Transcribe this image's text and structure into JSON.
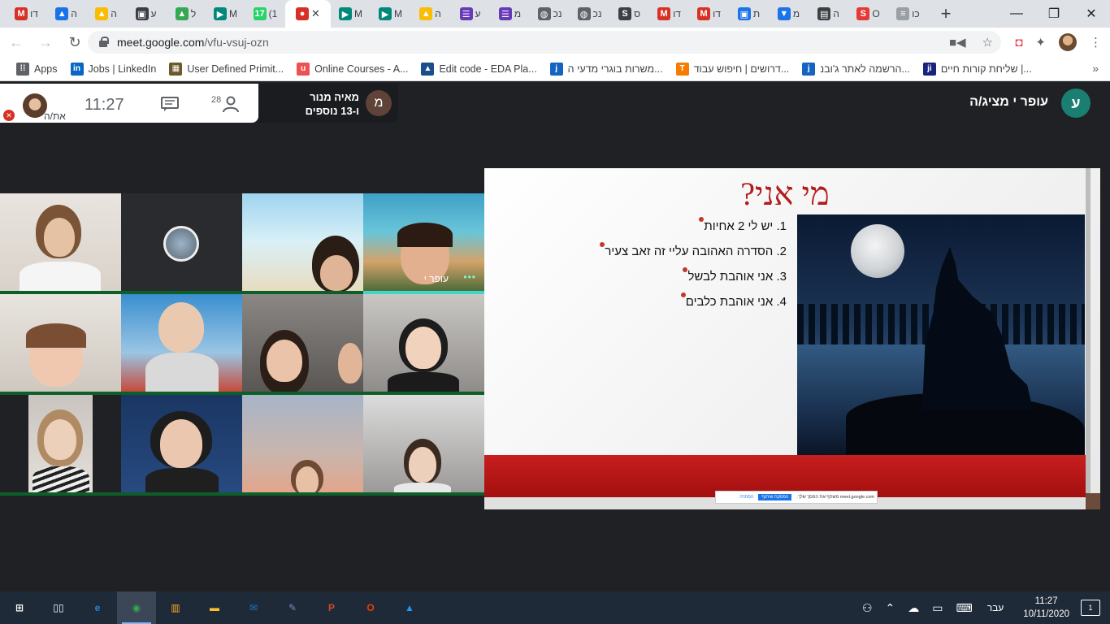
{
  "browser": {
    "tabs": [
      {
        "icon": "gmail-icon",
        "label": "דו",
        "color": "#d93025",
        "glyph": "M"
      },
      {
        "icon": "drive-icon",
        "label": "ה",
        "color": "#1a73e8",
        "glyph": "▲"
      },
      {
        "icon": "drive-icon",
        "label": "ה",
        "color": "#fbbc04",
        "glyph": "▲"
      },
      {
        "icon": "contacts-icon",
        "label": "ע",
        "color": "#3c4043",
        "glyph": "▣"
      },
      {
        "icon": "drive-icon",
        "label": "ל",
        "color": "#34a853",
        "glyph": "▲"
      },
      {
        "icon": "meet-icon",
        "label": "M",
        "color": "#00897b",
        "glyph": "▶"
      },
      {
        "icon": "whatsapp-icon",
        "label": "(1",
        "color": "#25d366",
        "glyph": "17"
      },
      {
        "icon": "record-icon",
        "label": "",
        "color": "#d93025",
        "glyph": "●",
        "active": true
      },
      {
        "icon": "meet-icon",
        "label": "M",
        "color": "#00897b",
        "glyph": "▶"
      },
      {
        "icon": "meet-icon",
        "label": "M",
        "color": "#00897b",
        "glyph": "▶"
      },
      {
        "icon": "drive-icon",
        "label": "ה",
        "color": "#fbbc04",
        "glyph": "▲"
      },
      {
        "icon": "forms-icon",
        "label": "ע",
        "color": "#673ab7",
        "glyph": "☰"
      },
      {
        "icon": "forms-icon",
        "label": "מ",
        "color": "#673ab7",
        "glyph": "☰"
      },
      {
        "icon": "globe-icon",
        "label": "נכ",
        "color": "#5f6368",
        "glyph": "◍"
      },
      {
        "icon": "globe-icon",
        "label": "נכ",
        "color": "#5f6368",
        "glyph": "◍"
      },
      {
        "icon": "s-icon",
        "label": "ס",
        "color": "#3c4043",
        "glyph": "S"
      },
      {
        "icon": "gmail-icon",
        "label": "דו",
        "color": "#d93025",
        "glyph": "M"
      },
      {
        "icon": "gmail-icon",
        "label": "דו",
        "color": "#d93025",
        "glyph": "M"
      },
      {
        "icon": "contacts-icon",
        "label": "ת",
        "color": "#1a73e8",
        "glyph": "▣"
      },
      {
        "icon": "chat-icon",
        "label": "מ",
        "color": "#1a73e8",
        "glyph": "▼"
      },
      {
        "icon": "news-icon",
        "label": "ה",
        "color": "#3c4043",
        "glyph": "▤"
      },
      {
        "icon": "red-s-icon",
        "label": "O",
        "color": "#e53935",
        "glyph": "S"
      },
      {
        "icon": "doc-icon",
        "label": "כו",
        "color": "#9aa0a6",
        "glyph": "≡"
      }
    ],
    "new_tab": "+",
    "window_controls": {
      "minimize": "—",
      "restore": "❐",
      "close": "✕"
    },
    "url_host": "meet.google.com",
    "url_path": "/vfu-vsuj-ozn",
    "bookmarks": [
      {
        "label": "Apps",
        "icon": "apps-grid-icon",
        "color": "#5f6368",
        "glyph": "⁞⁞"
      },
      {
        "label": "Jobs | LinkedIn",
        "icon": "linkedin-icon",
        "color": "#0a66c2",
        "glyph": "in"
      },
      {
        "label": "User Defined Primit...",
        "icon": "puzzle-bookmark-icon",
        "color": "#6b5b2a",
        "glyph": "▦"
      },
      {
        "label": "Online Courses - A...",
        "icon": "udemy-icon",
        "color": "#ec5252",
        "glyph": "u"
      },
      {
        "label": "Edit code - EDA Pla...",
        "icon": "eda-icon",
        "color": "#1a4f8b",
        "glyph": "▲"
      },
      {
        "label": "משרות בוגרי מדעי ה...",
        "icon": "jb-icon",
        "color": "#1565c0",
        "glyph": "j"
      },
      {
        "label": "דרושים | חיפוש עבוד...",
        "icon": "t-icon",
        "color": "#f57c00",
        "glyph": "T"
      },
      {
        "label": "הרשמה לאתר ג'ובנ...",
        "icon": "jb-icon",
        "color": "#1565c0",
        "glyph": "j"
      },
      {
        "label": "שליחת קורות חיים |...",
        "icon": "ji-icon",
        "color": "#1a237e",
        "glyph": "ji"
      }
    ],
    "bookmarks_more": "»"
  },
  "meet": {
    "self_label": "את/ה",
    "clock": "11:27",
    "people_count": "28",
    "speaker_name": "מאיה מנור",
    "speaker_more": "ו-13 נוספים",
    "speaker_initial": "מ",
    "presenter_label": "עופר י מציג/ה",
    "presenter_initial": "ע",
    "grid_tile_name": "עופר י",
    "grid_tile_dots": "•••",
    "slide": {
      "title": "מי אני?",
      "bullets": [
        "1. יש לי 2 אחיות",
        "2. הסדרה האהובה עליי זה זאב צעיר",
        "3. אני אוהבת לבשל",
        "4. אני אוהבת כלבים"
      ]
    },
    "share_banner": {
      "text": "meet.google.com משתף את המסך שלך.",
      "stop": "הפסקת שיתוף",
      "hide": "הסתרה"
    }
  },
  "taskbar": {
    "apps": [
      {
        "icon": "windows-start-icon",
        "color": "#ffffff",
        "glyph": "⊞"
      },
      {
        "icon": "task-view-icon",
        "color": "#ffffff",
        "glyph": "▯▯"
      },
      {
        "icon": "edge-icon",
        "color": "#1e88e5",
        "glyph": "e"
      },
      {
        "icon": "chrome-icon",
        "color": "#34a853",
        "glyph": "◉",
        "active": true
      },
      {
        "icon": "store-icon",
        "color": "#f9a825",
        "glyph": "▥"
      },
      {
        "icon": "file-explorer-icon",
        "color": "#fbc02d",
        "glyph": "▬"
      },
      {
        "icon": "mail-icon",
        "color": "#1976d2",
        "glyph": "✉"
      },
      {
        "icon": "paint-icon",
        "color": "#8e7cc3",
        "glyph": "✎"
      },
      {
        "icon": "powerpoint-icon",
        "color": "#d24726",
        "glyph": "P"
      },
      {
        "icon": "office-icon",
        "color": "#eb3c00",
        "glyph": "O"
      },
      {
        "icon": "photos-icon",
        "color": "#2196f3",
        "glyph": "▲"
      }
    ],
    "language": "עבר",
    "time": "11:27",
    "date": "10/11/2020",
    "notifications": "1"
  }
}
